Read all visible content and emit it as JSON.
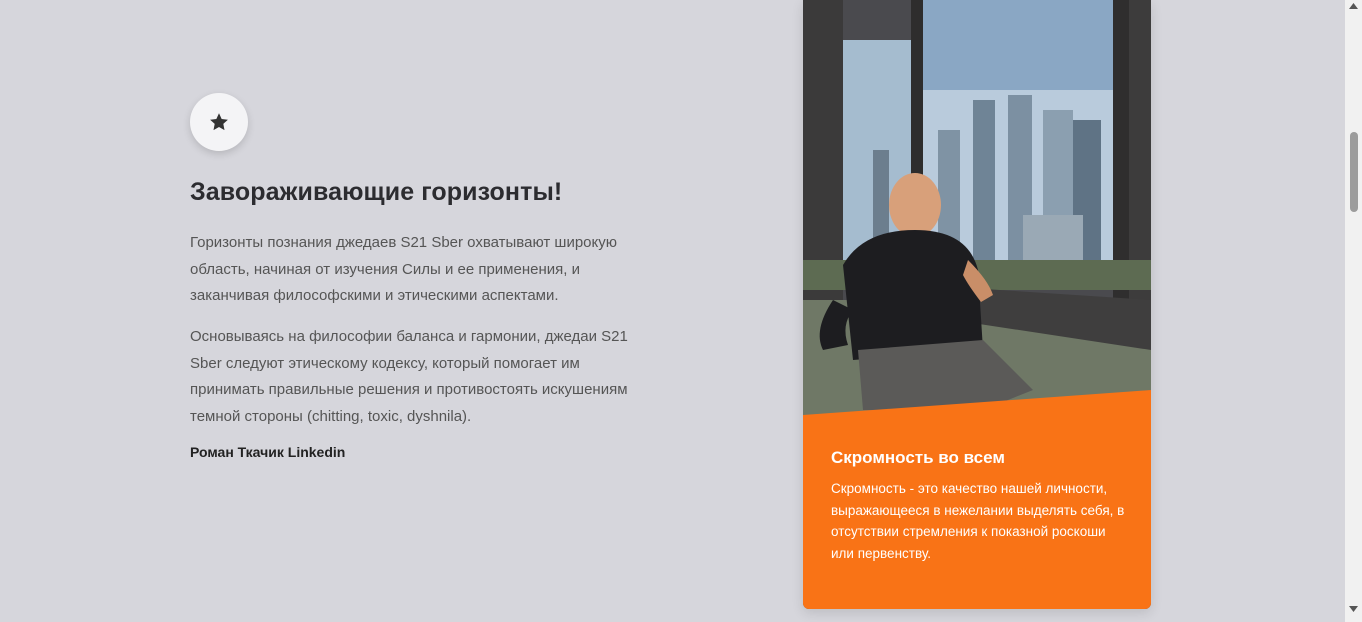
{
  "feature": {
    "icon": "star-icon",
    "title": "Завораживающие горизонты!",
    "paragraph1": "Горизонты познания джедаев S21 Sber охватывают широкую область, начиная от изучения Силы и ее применения, и заканчивая философскими и этическими аспектами.",
    "paragraph2": "Основываясь на философии баланса и гармонии, джедаи S21 Sber следуют этическому кодексу, который помогает им принимать правильные решения и противостоять искушениям темной стороны (chitting, toxic, dyshnila).",
    "author_name": "Роман Ткачик",
    "author_link": "Linkedin"
  },
  "card": {
    "photo": "man-by-window-city-skyline-photo",
    "title": "Скромность во всем",
    "text": "Скромность - это качество нашей личности, выражающееся в нежелании выделять себя, в отсутствии стремления к показной роскоши или первенству.",
    "accent_color": "#f97316"
  },
  "scrollbar": {
    "up_icon": "scroll-up-arrow-icon",
    "down_icon": "scroll-down-arrow-icon"
  }
}
